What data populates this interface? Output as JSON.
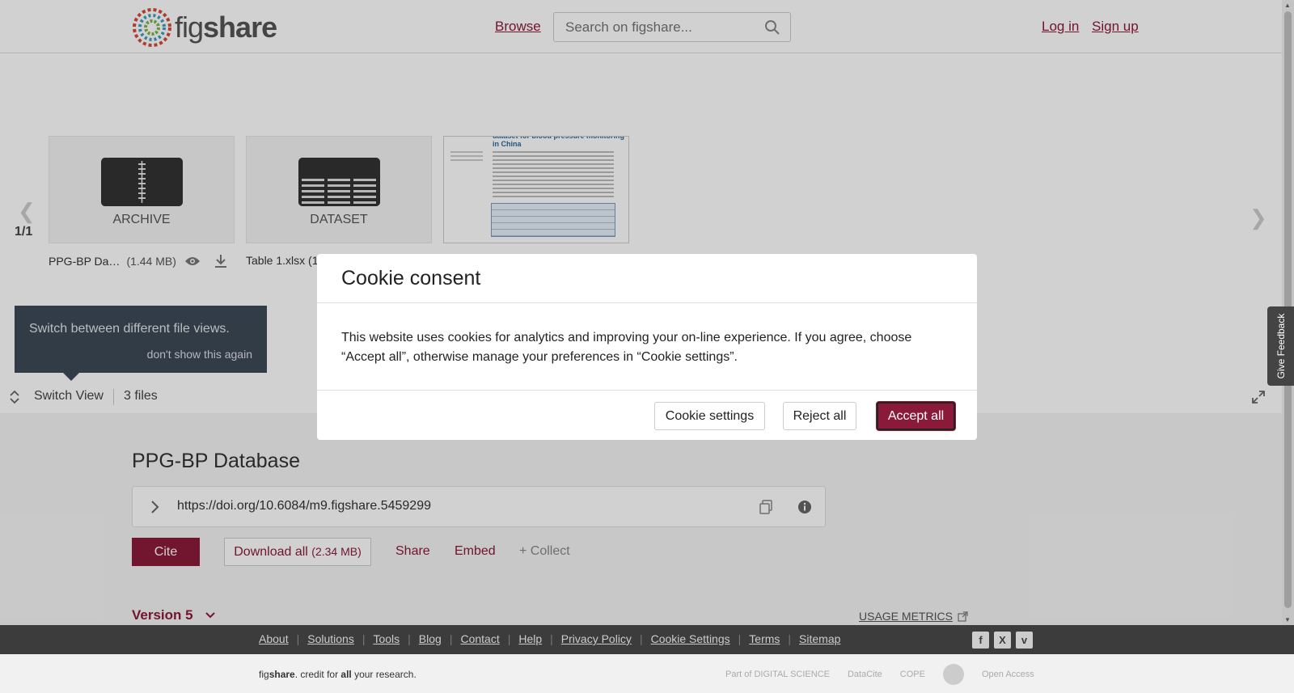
{
  "header": {
    "logo_text_fig": "fig",
    "logo_text_share": "share",
    "browse": "Browse",
    "search_placeholder": "Search on figshare...",
    "login": "Log in",
    "signup": "Sign up"
  },
  "viewer": {
    "pager": "1/1",
    "tiles": [
      {
        "label": "ARCHIVE",
        "name": "PPG-BP Da…",
        "size": "(1.44 MB)"
      },
      {
        "label": "DATASET",
        "name": "Table 1.xlsx (1",
        "size": ""
      },
      {
        "label": "",
        "name": "",
        "size": ""
      }
    ],
    "paper_title": "dataset for blood pressure monitoring in China",
    "tooltip": {
      "text": "Switch between different file views.",
      "dismiss": "don't show this again"
    },
    "switch_view": "Switch View",
    "files_count": "3 files"
  },
  "item": {
    "title": "PPG-BP Database",
    "doi": "https://doi.org/10.6084/m9.figshare.5459299",
    "cite": "Cite",
    "download_all": "Download all",
    "download_size": "(2.34 MB)",
    "share": "Share",
    "embed": "Embed",
    "collect": "+ Collect",
    "version": "Version 5",
    "usage_metrics": "USAGE METRICS"
  },
  "cookie": {
    "title": "Cookie consent",
    "body": "This website uses cookies for analytics and improving your on-line experience. If you agree, choose “Accept all”, otherwise manage your preferences in “Cookie settings”.",
    "settings": "Cookie settings",
    "reject": "Reject all",
    "accept": "Accept all"
  },
  "feedback": "Give Feedback",
  "footer": {
    "links": [
      "About",
      "Solutions",
      "Tools",
      "Blog",
      "Contact",
      "Help",
      "Privacy Policy",
      "Cookie Settings",
      "Terms",
      "Sitemap"
    ],
    "social": [
      "f",
      "X",
      "v"
    ],
    "credit_prefix": "fig",
    "credit_brand": "share",
    "credit_mid": ". credit for ",
    "credit_all": "all",
    "credit_end": " your research.",
    "partners": [
      "Part of DIGITAL SCIENCE",
      "DataCite",
      "COPE",
      "",
      "Open Access"
    ]
  },
  "colors": {
    "brand": "#8b1a3a",
    "footer_dark": "#3c3c3c",
    "tooltip": "#3c4a57"
  }
}
